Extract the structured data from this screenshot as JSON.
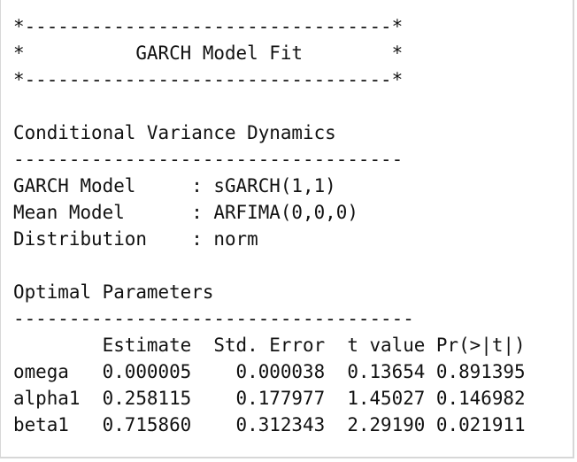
{
  "console": {
    "lines": [
      "*---------------------------------*",
      "*          GARCH Model Fit        *",
      "*---------------------------------*",
      "",
      "Conditional Variance Dynamics",
      "-----------------------------------",
      "GARCH Model     : sGARCH(1,1)",
      "Mean Model      : ARFIMA(0,0,0)",
      "Distribution    : norm",
      "",
      "Optimal Parameters",
      "------------------------------------",
      "        Estimate  Std. Error  t value Pr(>|t|)",
      "omega   0.000005    0.000038  0.13654 0.891395",
      "alpha1  0.258115    0.177977  1.45027 0.146982",
      "beta1   0.715860    0.312343  2.29190 0.021911"
    ]
  }
}
